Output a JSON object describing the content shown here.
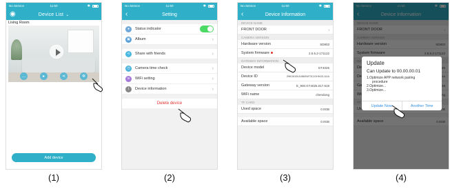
{
  "status": {
    "carrier": "No Service",
    "time": "11:50"
  },
  "screen1": {
    "title": "Device List",
    "room": "Living Room",
    "add_button": "Add device",
    "controls": [
      "speech-icon",
      "record-icon",
      "share-icon",
      "gear-icon"
    ]
  },
  "screen2": {
    "title": "Setting",
    "items": [
      {
        "label": "Status indicator",
        "icon": "status-icon"
      },
      {
        "label": "Album",
        "icon": "album-icon"
      },
      {
        "label": "Share with friends",
        "icon": "share-icon"
      },
      {
        "label": "Camera time check",
        "icon": "clock-icon"
      },
      {
        "label": "WiFi setting",
        "icon": "wifi-icon"
      },
      {
        "label": "Device information",
        "icon": "info-icon"
      }
    ],
    "delete": "Delete device"
  },
  "screen3": {
    "title": "Device Information",
    "sec_name": "DEVICE NAME",
    "device_name": "FRONT DOOR",
    "sec_cam": "CAMERA VERSION",
    "hw_label": "Hardware version",
    "hw_value": "SD803",
    "fw_label": "System firmware",
    "fw_value": "2.5.5.2-171122",
    "sec_gw": "GATEWAY INFORMATION",
    "model_label": "Device model",
    "model_value": "GT4025",
    "id_label": "Device ID",
    "id_value": "Z9KO6100JU88GWT3CJGHHJ2L111A",
    "gwv_label": "Gateway version",
    "gwv_value": "E_900.GT4025.017.619",
    "wifi_label": "WiFi name",
    "wifi_value": "chendong",
    "sec_tf": "TF CARD",
    "used_label": "Used space",
    "used_value": "0.0GB",
    "avail_label": "Available space",
    "avail_value": "0.0GB"
  },
  "screen4": {
    "dialog_title": "Update",
    "dialog_msg": "Can Update to 00.00.00.01",
    "dialog_lines": [
      "1.Optimize APP network pairing",
      "procedure",
      "2.Optimize...",
      "3.Optimize..."
    ],
    "update_btn": "Update Now",
    "later_btn": "Another Time"
  },
  "captions": [
    "(1)",
    "(2)",
    "(3)",
    "(4)"
  ]
}
